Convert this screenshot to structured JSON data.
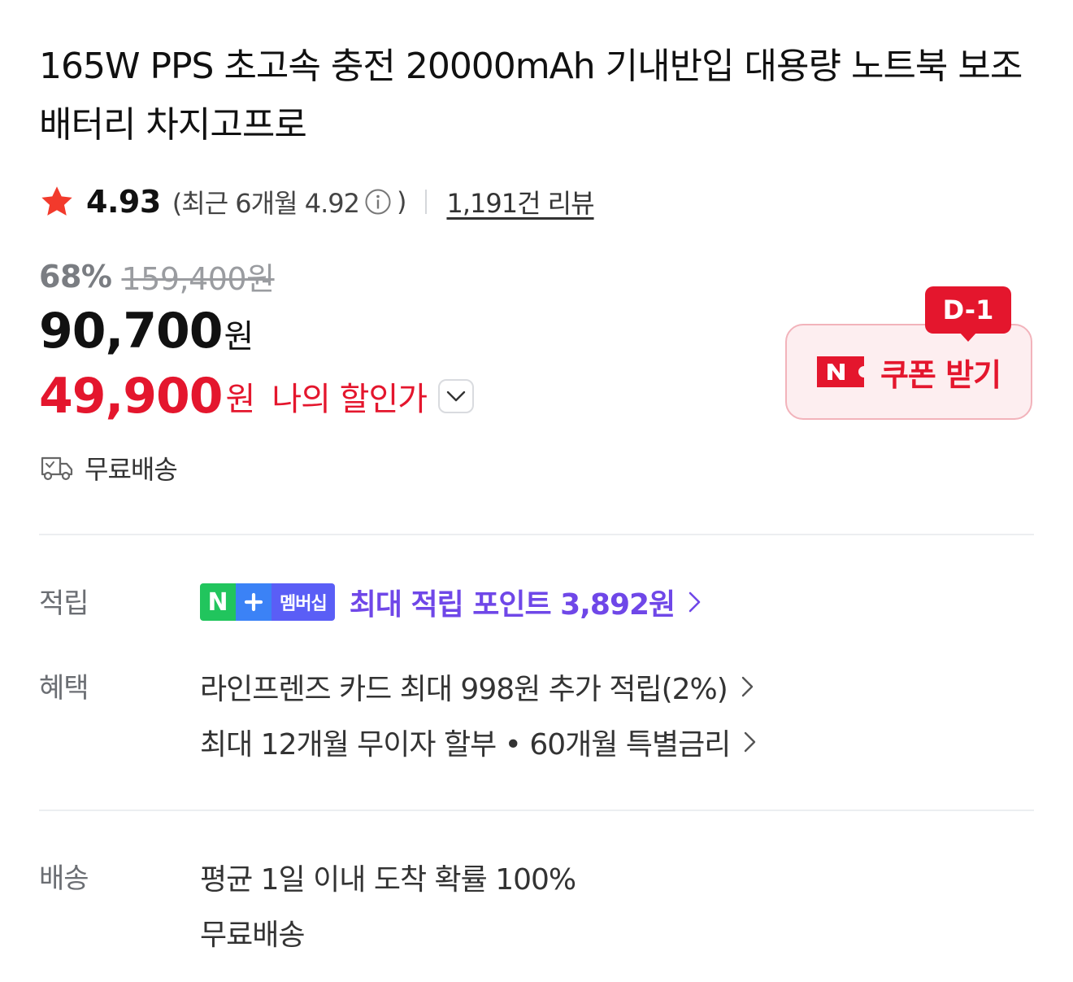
{
  "product": {
    "title": "165W PPS 초고속 충전 20000mAh 기내반입 대용량 노트북 보조배터리 차지고프로"
  },
  "rating": {
    "score": "4.93",
    "recent_prefix": "(최근 6개월 4.92",
    "recent_suffix": ")",
    "review_link": "1,191건 리뷰",
    "star_color": "#f23a2c"
  },
  "price": {
    "discount_rate": "68%",
    "original": "159,400원",
    "sale_amount": "90,700",
    "sale_unit": "원",
    "my_amount": "49,900",
    "my_unit": "원",
    "my_label": "나의 할인가",
    "accent_color": "#e4162d"
  },
  "coupon": {
    "badge": "D-1",
    "label": "쿠폰 받기",
    "icon": "naver-coupon-icon"
  },
  "shipping_summary": {
    "icon": "truck-icon",
    "text": "무료배송"
  },
  "points": {
    "label": "적립",
    "badge_n": "N",
    "badge_text": "멤버십",
    "text": "최대 적립 포인트 3,892원",
    "color": "#6f47e8"
  },
  "benefits": {
    "label": "혜택",
    "items": [
      "라인프렌즈 카드 최대 998원 추가 적립(2%)",
      "최대 12개월 무이자 할부 • 60개월 특별금리"
    ]
  },
  "delivery": {
    "label": "배송",
    "lines": [
      "평균 1일 이내 도착 확률 100%",
      "무료배송"
    ]
  }
}
